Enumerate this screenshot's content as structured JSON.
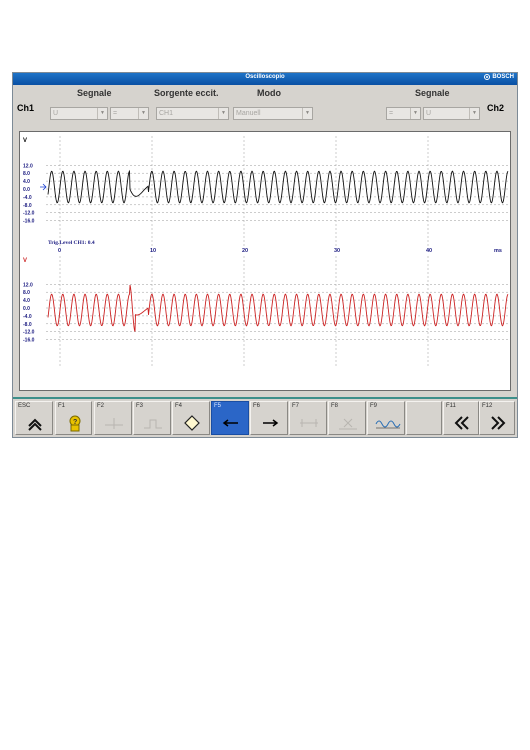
{
  "window": {
    "title": "Oscilloscopio",
    "brand": "BOSCH"
  },
  "header": {
    "ch1_label": "Ch1",
    "ch2_label": "Ch2",
    "segnale_left_label": "Segnale",
    "sorgente_label": "Sorgente eccit.",
    "modo_label": "Modo",
    "segnale_right_label": "Segnale",
    "ch1_signal_value": "U",
    "ch1_coupling_value": "=",
    "coupling_mid_value": "=",
    "trigger_source_value": "CH1",
    "modo_value": "Manuell",
    "ch2_coupling_value": "=",
    "ch2_signal_value": "U"
  },
  "scope": {
    "unit_label": "V",
    "y_ticks": [
      "12.0",
      "8.0",
      "4.0",
      "0.0",
      "-4.0",
      "-8.0",
      "-12.0",
      "-16.0"
    ],
    "x_ticks": [
      "0",
      "10",
      "20",
      "30",
      "40"
    ],
    "x_unit": "ms",
    "trigger_text": "Trig.Level CH1:  0.4",
    "ch1_color": "#111111",
    "ch2_color": "#cc2222",
    "grid_color": "#9a9a9a"
  },
  "toolbar": {
    "keys": [
      {
        "key": "ESC",
        "icon": "double-up-chevron-icon"
      },
      {
        "key": "F1",
        "icon": "help-person-icon"
      },
      {
        "key": "F2",
        "icon": "disabled-cursor-icon"
      },
      {
        "key": "F3",
        "icon": "disabled-trigger-icon"
      },
      {
        "key": "F4",
        "icon": "diamond-icon"
      },
      {
        "key": "F5",
        "icon": "arrow-left-icon"
      },
      {
        "key": "F6",
        "icon": "arrow-right-icon"
      },
      {
        "key": "F7",
        "icon": "disabled-measure-icon"
      },
      {
        "key": "F8",
        "icon": "disabled-x-icon"
      },
      {
        "key": "F9",
        "icon": "waveform-icon"
      },
      {
        "key": "F11",
        "icon": "double-left-chevron-icon"
      },
      {
        "key": "F12",
        "icon": "double-right-chevron-icon"
      }
    ],
    "active_key": "F5",
    "active_color": "#2b66c7"
  }
}
